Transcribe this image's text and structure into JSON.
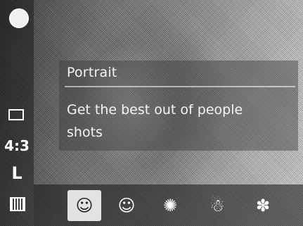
{
  "info": {
    "mode_title": "Portrait",
    "mode_description": "Get the best out of people shots"
  },
  "left_status": {
    "aspect_ratio": "4:3",
    "image_size": "L"
  },
  "scene_modes": [
    {
      "name": "portrait-icon",
      "glyph": "☺",
      "selected": true
    },
    {
      "name": "smile-icon",
      "glyph": "☺",
      "selected": false
    },
    {
      "name": "fireworks-icon",
      "glyph": "✺",
      "selected": false
    },
    {
      "name": "snow-icon",
      "glyph": "☃",
      "selected": false
    },
    {
      "name": "night-scene-icon",
      "glyph": "✽",
      "selected": false
    }
  ]
}
